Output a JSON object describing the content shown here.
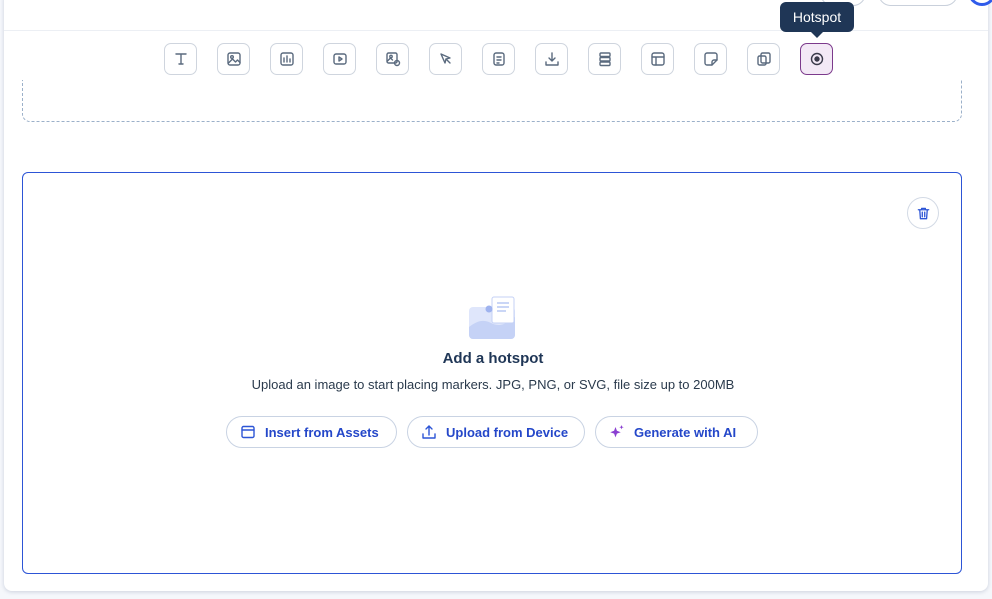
{
  "toolbar": {
    "tools": [
      {
        "name": "text-tool",
        "icon": "text-icon"
      },
      {
        "name": "image-tool",
        "icon": "image-icon"
      },
      {
        "name": "chart-tool",
        "icon": "bar-chart-icon"
      },
      {
        "name": "video-tool",
        "icon": "video-icon"
      },
      {
        "name": "image-hotspot-tool",
        "icon": "image-plus-icon"
      },
      {
        "name": "interaction-tool",
        "icon": "cursor-icon"
      },
      {
        "name": "document-tool",
        "icon": "document-icon"
      },
      {
        "name": "download-tool",
        "icon": "download-icon"
      },
      {
        "name": "layers-tool",
        "icon": "stack-icon"
      },
      {
        "name": "layout-tool",
        "icon": "layout-icon"
      },
      {
        "name": "sticker-tool",
        "icon": "sticker-icon"
      },
      {
        "name": "duplicate-tool",
        "icon": "copy-icon"
      },
      {
        "name": "hotspot-tool",
        "icon": "target-icon",
        "active": true
      }
    ],
    "tooltip": "Hotspot"
  },
  "hotspot_block": {
    "title": "Add a hotspot",
    "description": "Upload an image to start placing markers. JPG, PNG, or SVG, file size up to 200MB",
    "buttons": {
      "insert_assets": "Insert from Assets",
      "upload_device": "Upload from Device",
      "generate_ai": "Generate with AI"
    }
  },
  "colors": {
    "accent": "#2d55d6",
    "tooltip_bg": "#1f3656",
    "active_tool_bg": "#f3e9f6",
    "active_tool_border": "#7c3a8c",
    "ai_sparkle": "#8a3fd1"
  }
}
